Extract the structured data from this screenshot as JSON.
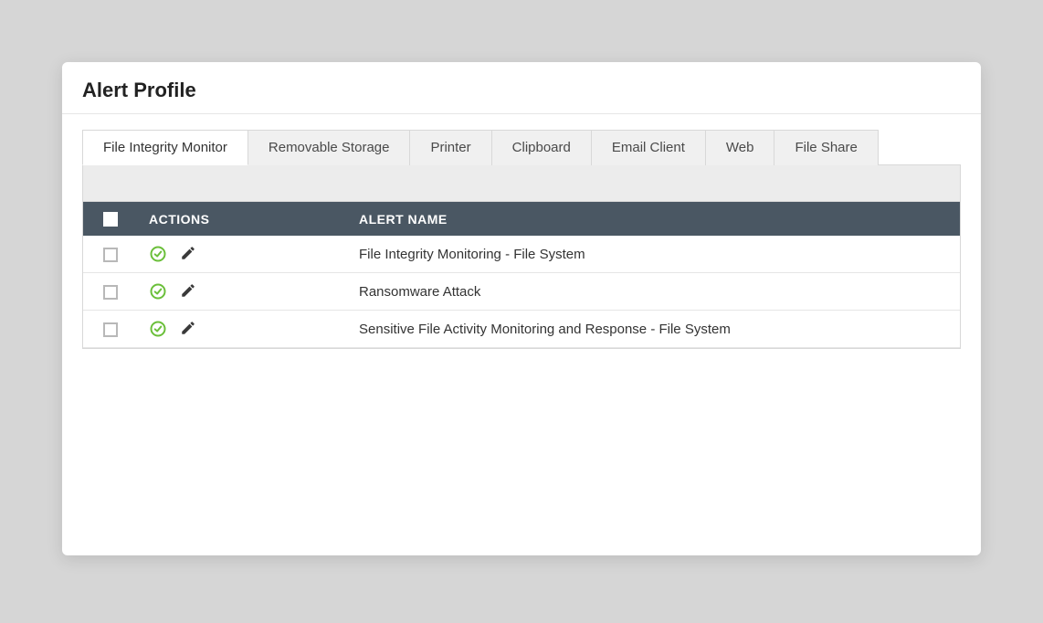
{
  "page_title": "Alert Profile",
  "tabs": [
    {
      "label": "File Integrity Monitor",
      "active": true
    },
    {
      "label": "Removable Storage",
      "active": false
    },
    {
      "label": "Printer",
      "active": false
    },
    {
      "label": "Clipboard",
      "active": false
    },
    {
      "label": "Email Client",
      "active": false
    },
    {
      "label": "Web",
      "active": false
    },
    {
      "label": "File Share",
      "active": false
    }
  ],
  "table": {
    "headers": {
      "actions": "ACTIONS",
      "alert_name": "ALERT NAME"
    },
    "rows": [
      {
        "name": "File Integrity Monitoring - File System"
      },
      {
        "name": "Ransomware Attack"
      },
      {
        "name": "Sensitive File Activity Monitoring and Response - File System"
      }
    ]
  },
  "icons": {
    "enable": "check-circle-icon",
    "edit": "pencil-icon"
  },
  "colors": {
    "header_bg": "#4a5763",
    "check_green": "#6bbf3a"
  }
}
